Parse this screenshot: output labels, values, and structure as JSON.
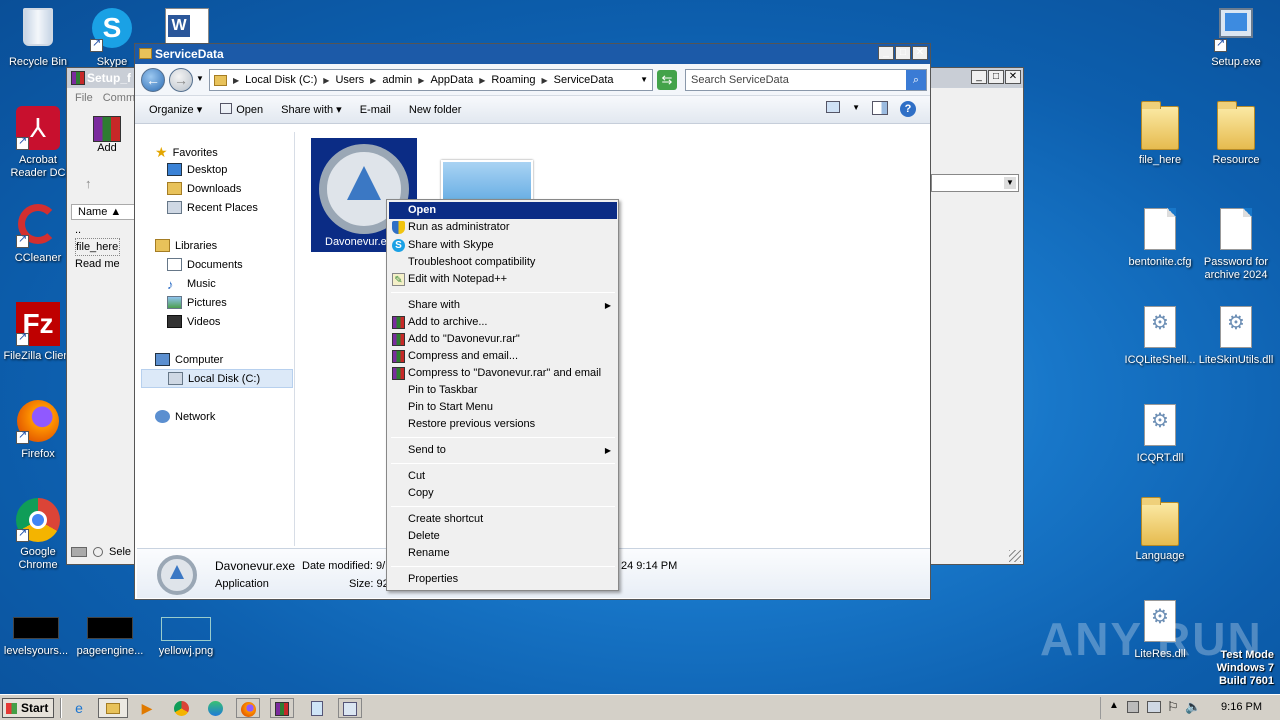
{
  "desktop": {
    "left_icons": [
      {
        "label": "Recycle Bin"
      },
      {
        "label": "Skype"
      },
      {
        "label": "Acrobat Reader DC"
      },
      {
        "label": "CCleaner"
      },
      {
        "label": "FileZilla Client"
      },
      {
        "label": "Firefox"
      },
      {
        "label": "Google Chrome"
      },
      {
        "label": "levelsyours..."
      },
      {
        "label": "pageengine..."
      },
      {
        "label": "yellowj.png"
      }
    ],
    "right_icons": [
      {
        "label": "Setup.exe"
      },
      {
        "label": "file_here"
      },
      {
        "label": "Resource"
      },
      {
        "label": "bentonite.cfg"
      },
      {
        "label": "Password for archive 2024"
      },
      {
        "label": "ICQLiteShell..."
      },
      {
        "label": "LiteSkinUtils.dll"
      },
      {
        "label": "ICQRT.dll"
      },
      {
        "label": "Language"
      },
      {
        "label": "LiteRes.dll"
      }
    ],
    "watermark": "ANY RUN",
    "test_mode": [
      "Test Mode",
      "Windows 7",
      "Build 7601"
    ]
  },
  "back_window": {
    "title": "Setup_f",
    "menu": [
      "File",
      "Comm"
    ],
    "toolbar_add": "Add",
    "col_name": "Name",
    "rows": [
      "..",
      "file_here",
      "Read me"
    ],
    "status": "Sele"
  },
  "explorer": {
    "title": "ServiceData",
    "breadcrumbs": [
      "Local Disk (C:)",
      "Users",
      "admin",
      "AppData",
      "Roaming",
      "ServiceData"
    ],
    "search_placeholder": "Search ServiceData",
    "toolbar": {
      "organize": "Organize",
      "open": "Open",
      "share_with": "Share with",
      "email": "E-mail",
      "new_folder": "New folder"
    },
    "nav": {
      "favorites": "Favorites",
      "favorites_items": [
        "Desktop",
        "Downloads",
        "Recent Places"
      ],
      "libraries": "Libraries",
      "libraries_items": [
        "Documents",
        "Music",
        "Pictures",
        "Videos"
      ],
      "computer": "Computer",
      "local_disk": "Local Disk (C:)",
      "network": "Network"
    },
    "files": [
      {
        "name": "Davonevur.exe",
        "short": "Davonevur.e"
      }
    ],
    "details": {
      "name": "Davonevur.exe",
      "type": "Application",
      "date_label": "Date modified: 9/",
      "date_tail": "24 9:14 PM",
      "size_label": "Size: 92"
    }
  },
  "context_menu": {
    "groups": [
      [
        "Open",
        "Run as administrator",
        "Share with Skype",
        "Troubleshoot compatibility",
        "Edit with Notepad++"
      ],
      [
        "Share with",
        "Add to archive...",
        "Add to \"Davonevur.rar\"",
        "Compress and email...",
        "Compress to \"Davonevur.rar\" and email",
        "Pin to Taskbar",
        "Pin to Start Menu",
        "Restore previous versions"
      ],
      [
        "Send to"
      ],
      [
        "Cut",
        "Copy"
      ],
      [
        "Create shortcut",
        "Delete",
        "Rename"
      ],
      [
        "Properties"
      ]
    ]
  },
  "taskbar": {
    "start": "Start",
    "clock": "9:16 PM"
  }
}
